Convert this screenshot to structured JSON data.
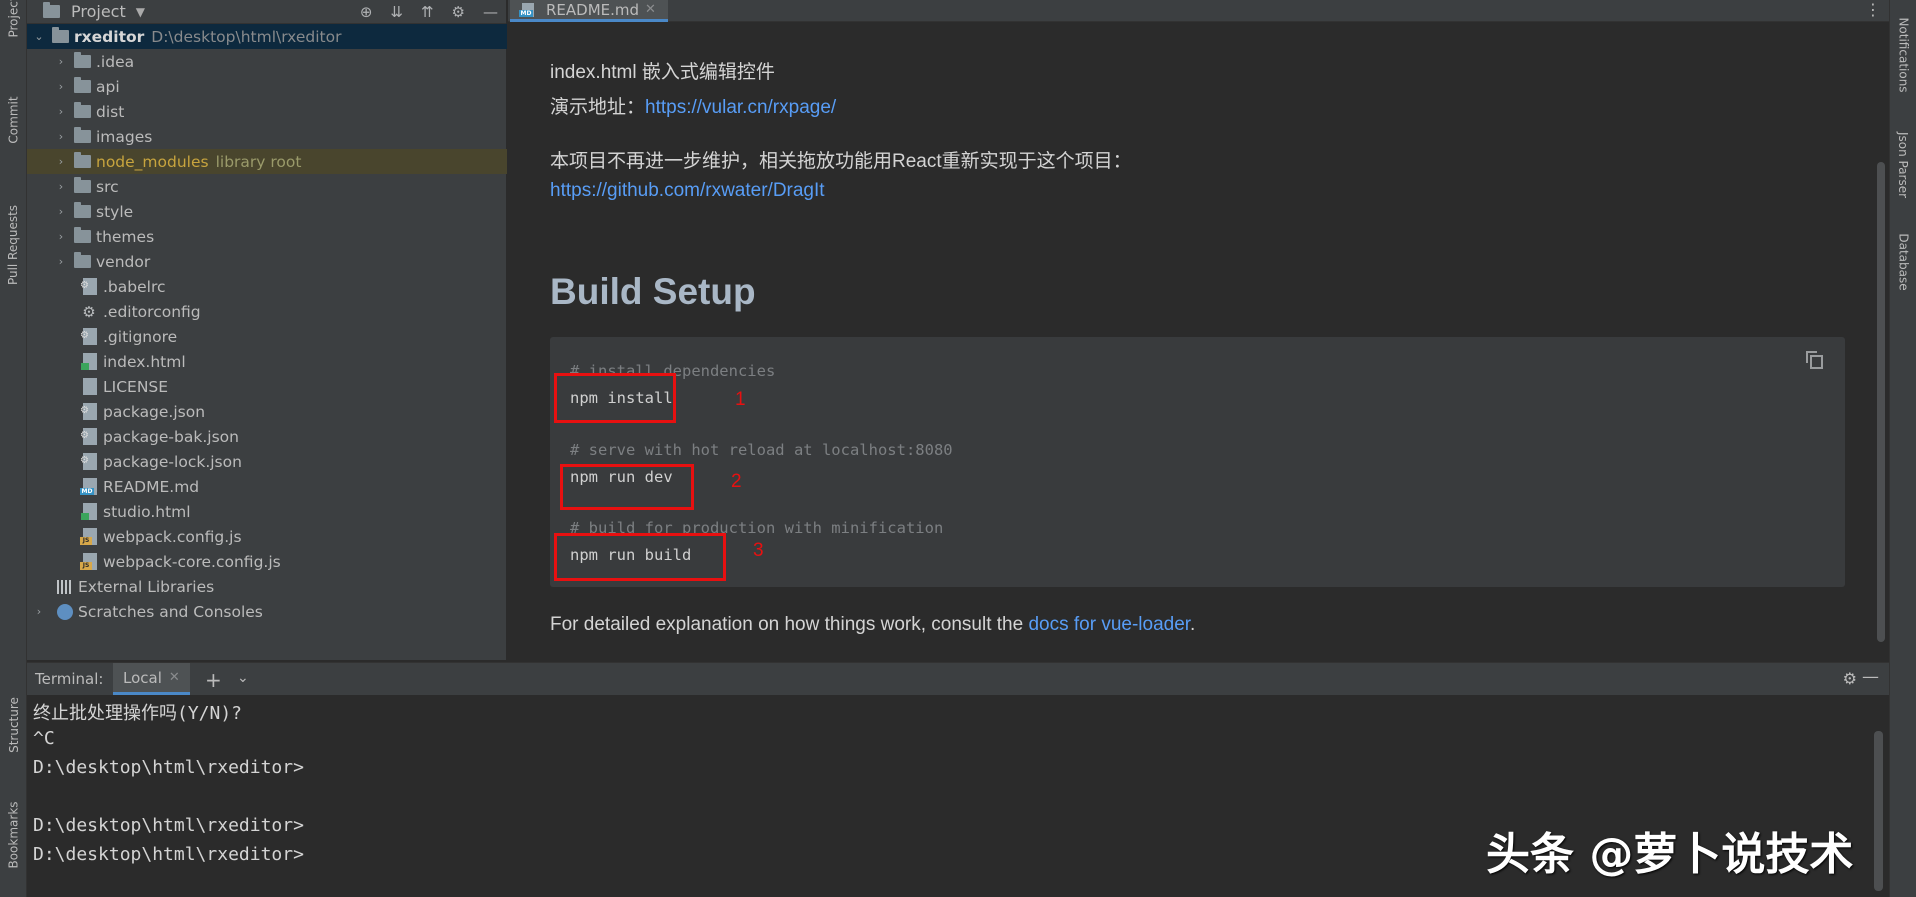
{
  "left_strip": {
    "project": "Project",
    "commit": "Commit",
    "pull_requests": "Pull Requests",
    "structure": "Structure",
    "bookmarks": "Bookmarks"
  },
  "right_strip": {
    "notifications": "Notifications",
    "json_parser": "Json Parser",
    "database": "Database"
  },
  "project_panel": {
    "title": "Project",
    "root": {
      "name": "rxeditor",
      "path": "D:\\desktop\\html\\rxeditor"
    },
    "folders": [
      ".idea",
      "api",
      "dist",
      "images",
      "node_modules",
      "src",
      "style",
      "themes",
      "vendor"
    ],
    "node_modules_note": "library root",
    "files": [
      ".babelrc",
      ".editorconfig",
      ".gitignore",
      "index.html",
      "LICENSE",
      "package.json",
      "package-bak.json",
      "package-lock.json",
      "README.md",
      "studio.html",
      "webpack.config.js",
      "webpack-core.config.js"
    ],
    "external_libraries": "External Libraries",
    "scratches": "Scratches and Consoles"
  },
  "editor": {
    "tab_label": "README.md",
    "line_index": "index.html 嵌入式编辑控件",
    "demo_label": "演示地址：",
    "demo_url": "https://vular.cn/rxpage/",
    "maint_note": "本项目不再进一步维护，相关拖放功能用React重新实现于这个项目：",
    "dragit_url": "https://github.com/rxwater/DragIt",
    "heading": "Build Setup",
    "code": {
      "c1": "# install dependencies",
      "cmd1": "npm install",
      "c2": "# serve with hot reload at localhost:8080",
      "cmd2": "npm run dev",
      "c3": "# build for production with minification",
      "cmd3": "npm run build"
    },
    "annotations": [
      "1",
      "2",
      "3"
    ],
    "footer_text": "For detailed explanation on how things work, consult the ",
    "footer_link": "docs for vue-loader",
    "footer_end": "."
  },
  "terminal": {
    "label": "Terminal:",
    "tab": "Local",
    "lines": [
      "终止批处理操作吗(Y/N)?",
      "^C",
      "D:\\desktop\\html\\rxeditor>",
      "",
      "D:\\desktop\\html\\rxeditor>",
      "D:\\desktop\\html\\rxeditor>"
    ]
  },
  "watermark": "头条 @萝卜说技术"
}
